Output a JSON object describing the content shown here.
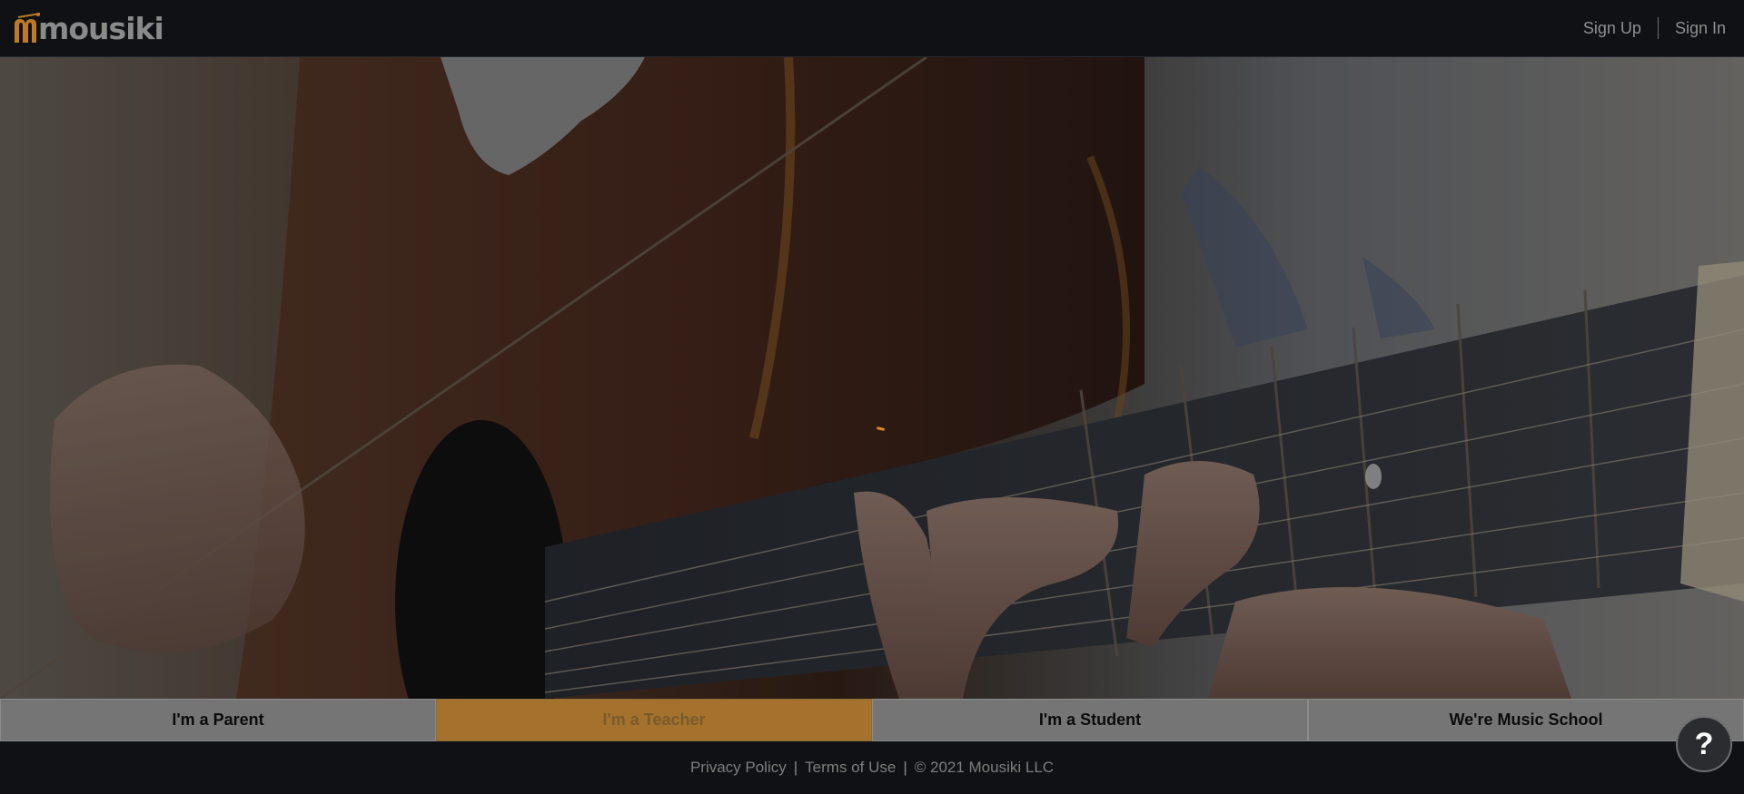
{
  "header": {
    "logo_text": "mousiki",
    "sign_up": "Sign Up",
    "sign_in": "Sign In"
  },
  "roles": [
    {
      "label": "I'm a Parent",
      "active": false
    },
    {
      "label": "I'm a Teacher",
      "active": true
    },
    {
      "label": "I'm a Student",
      "active": false
    },
    {
      "label": "We're Music School",
      "active": false
    }
  ],
  "footer": {
    "privacy": "Privacy Policy",
    "separator": "|",
    "terms": "Terms of Use",
    "copyright": "© 2021 Mousiki LLC"
  },
  "help_button": "?",
  "colors": {
    "brand_accent": "#a5722e",
    "header_bg": "#0f1114"
  },
  "icons": {
    "logo": "mousiki-guitar-logo-icon",
    "help": "question-mark-icon",
    "spinner": "loading-spinner-icon"
  }
}
